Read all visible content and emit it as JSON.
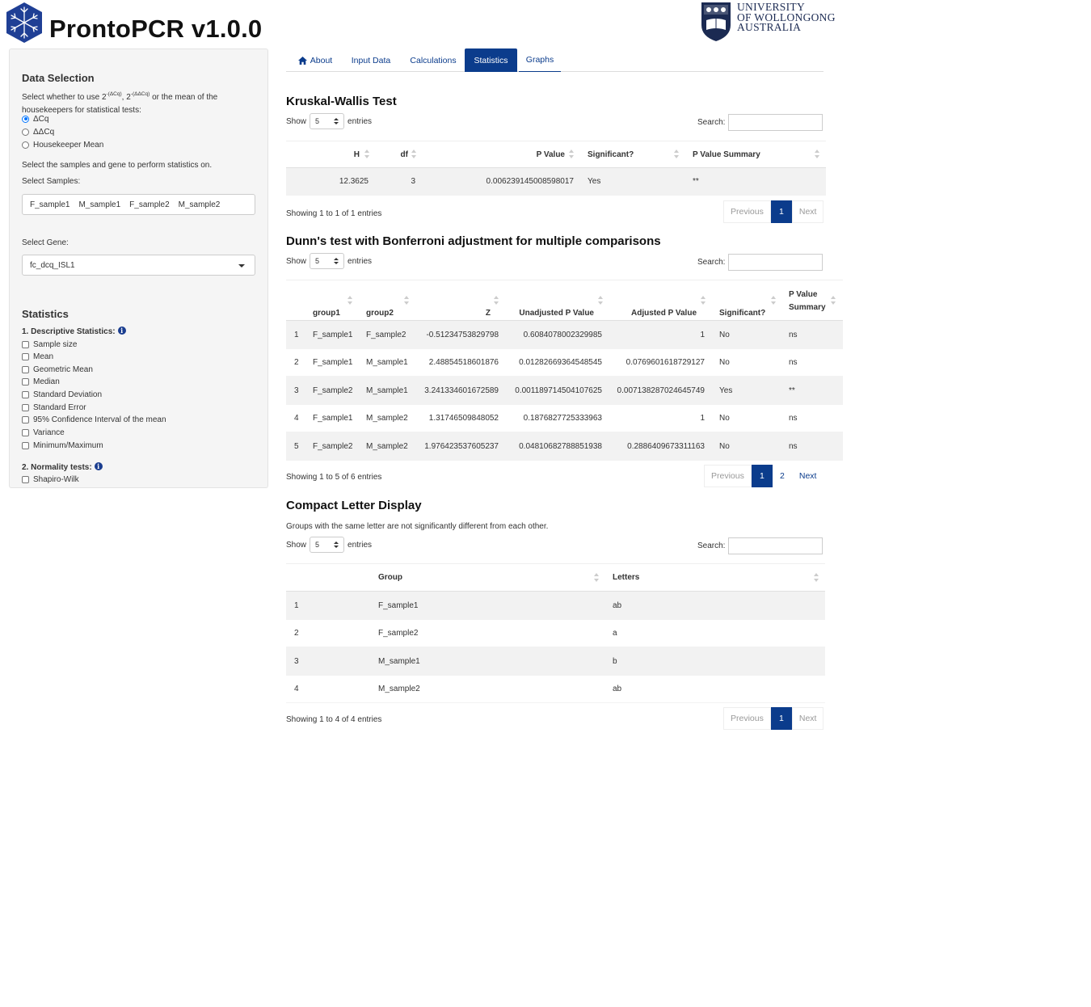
{
  "app": {
    "title": "ProntoPCR v1.0.0"
  },
  "university": {
    "line1": "UNIVERSITY",
    "line2": "OF WOLLONGONG",
    "line3": "AUSTRALIA"
  },
  "sidebar": {
    "data_selection_title": "Data Selection",
    "select_text_a": "Select whether to use 2",
    "select_text_sup1": "-(ΔCq)",
    "select_text_b": ", 2",
    "select_text_sup2": "-(ΔΔCq)",
    "select_text_c": " or the mean of the",
    "select_text_line2": "housekeepers for statistical tests:",
    "radio_options": [
      "ΔCq",
      "ΔΔCq",
      "Housekeeper Mean"
    ],
    "radio_selected": 0,
    "samples_gene_text": "Select the samples and gene to perform statistics on.",
    "select_samples_label": "Select Samples:",
    "selected_samples": [
      "F_sample1",
      "M_sample1",
      "F_sample2",
      "M_sample2"
    ],
    "select_gene_label": "Select Gene:",
    "selected_gene": "fc_dcq_ISL1",
    "statistics_title": "Statistics",
    "descriptive_title": "1. Descriptive Statistics:",
    "descriptive_options": [
      "Sample size",
      "Mean",
      "Geometric Mean",
      "Median",
      "Standard Deviation",
      "Standard Error",
      "95% Confidence Interval of the mean",
      "Variance",
      "Minimum/Maximum"
    ],
    "normality_title": "2. Normality tests:",
    "normality_options": [
      "Shapiro-Wilk"
    ]
  },
  "tabs": [
    "About",
    "Input Data",
    "Calculations",
    "Statistics",
    "Graphs"
  ],
  "active_tab": "Statistics",
  "common": {
    "show": "Show",
    "entries": "entries",
    "search": "Search:",
    "page_length": "5",
    "previous": "Previous",
    "next": "Next"
  },
  "kruskal": {
    "title": "Kruskal-Wallis Test",
    "headers": [
      "H",
      "df",
      "P Value",
      "Significant?",
      "P Value Summary"
    ],
    "rows": [
      [
        "12.3625",
        "3",
        "0.006239145008598017",
        "Yes",
        "**"
      ]
    ],
    "info": "Showing 1 to 1 of 1 entries",
    "pages": [
      "1"
    ]
  },
  "dunn": {
    "title": "Dunn's test with Bonferroni adjustment for multiple comparisons",
    "headers": [
      "",
      "group1",
      "group2",
      "Z",
      "Unadjusted P Value",
      "Adjusted P Value",
      "Significant?",
      "P Value",
      "Summary"
    ],
    "rows": [
      [
        "1",
        "F_sample1",
        "F_sample2",
        "-0.51234753829798",
        "0.6084078002329985",
        "1",
        "No",
        "ns"
      ],
      [
        "2",
        "F_sample1",
        "M_sample1",
        "2.48854518601876",
        "0.01282669364548545",
        "0.0769601618729127",
        "No",
        "ns"
      ],
      [
        "3",
        "F_sample2",
        "M_sample1",
        "3.241334601672589",
        "0.001189714504107625",
        "0.007138287024645749",
        "Yes",
        "**"
      ],
      [
        "4",
        "F_sample1",
        "M_sample2",
        "1.31746509848052",
        "0.1876827725333963",
        "1",
        "No",
        "ns"
      ],
      [
        "5",
        "F_sample2",
        "M_sample2",
        "1.976423537605237",
        "0.04810682788851938",
        "0.2886409673311163",
        "No",
        "ns"
      ]
    ],
    "info": "Showing 1 to 5 of 6 entries",
    "pages": [
      "1",
      "2"
    ]
  },
  "cld": {
    "title": "Compact Letter Display",
    "note": "Groups with the same letter are not significantly different from each other.",
    "headers": [
      "",
      "Group",
      "Letters"
    ],
    "rows": [
      [
        "1",
        "F_sample1",
        "ab"
      ],
      [
        "2",
        "F_sample2",
        "a"
      ],
      [
        "3",
        "M_sample1",
        "b"
      ],
      [
        "4",
        "M_sample2",
        "ab"
      ]
    ],
    "info": "Showing 1 to 4 of 4 entries",
    "pages": [
      "1"
    ]
  }
}
